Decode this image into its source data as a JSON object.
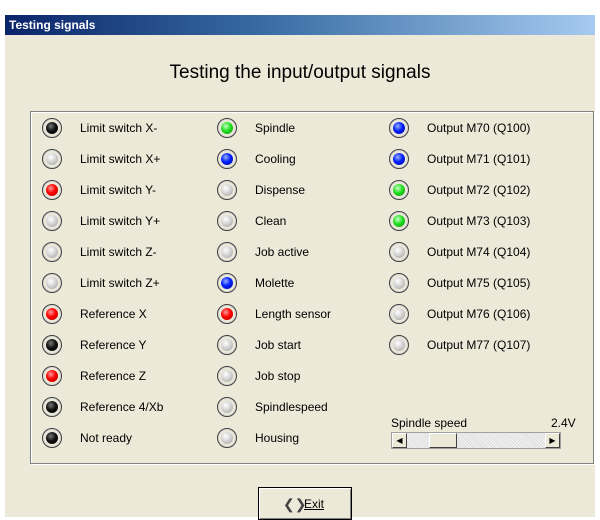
{
  "window": {
    "title": "Testing signals"
  },
  "heading": "Testing the input/output signals",
  "columns": [
    [
      {
        "label": "Limit switch X-",
        "state": "black"
      },
      {
        "label": "Limit switch X+",
        "state": "off"
      },
      {
        "label": "Limit switch Y-",
        "state": "red"
      },
      {
        "label": "Limit switch Y+",
        "state": "off"
      },
      {
        "label": "Limit switch Z-",
        "state": "off"
      },
      {
        "label": "Limit switch Z+",
        "state": "off"
      },
      {
        "label": "Reference X",
        "state": "red"
      },
      {
        "label": "Reference Y",
        "state": "black"
      },
      {
        "label": "Reference Z",
        "state": "red"
      },
      {
        "label": "Reference 4/Xb",
        "state": "black"
      },
      {
        "label": "Not ready",
        "state": "black"
      }
    ],
    [
      {
        "label": "Spindle",
        "state": "green"
      },
      {
        "label": "Cooling",
        "state": "blue"
      },
      {
        "label": "Dispense",
        "state": "off"
      },
      {
        "label": "Clean",
        "state": "off"
      },
      {
        "label": "Job active",
        "state": "off"
      },
      {
        "label": "Molette",
        "state": "blue"
      },
      {
        "label": "Length sensor",
        "state": "red"
      },
      {
        "label": "Job start",
        "state": "off"
      },
      {
        "label": "Job stop",
        "state": "off"
      },
      {
        "label": "Spindlespeed",
        "state": "off"
      },
      {
        "label": "Housing",
        "state": "off"
      }
    ],
    [
      {
        "label": "Output M70 (Q100)",
        "state": "blue"
      },
      {
        "label": "Output M71 (Q101)",
        "state": "blue"
      },
      {
        "label": "Output M72 (Q102)",
        "state": "green"
      },
      {
        "label": "Output M73 (Q103)",
        "state": "green"
      },
      {
        "label": "Output M74 (Q104)",
        "state": "off"
      },
      {
        "label": "Output M75 (Q105)",
        "state": "off"
      },
      {
        "label": "Output M76 (Q106)",
        "state": "off"
      },
      {
        "label": "Output M77 (Q107)",
        "state": "off"
      }
    ]
  ],
  "spindle": {
    "label": "Spindle speed",
    "value": "2.4V",
    "slider_position": 0.2
  },
  "exit_button": {
    "label": "Exit"
  },
  "colors": {
    "titlebar_start": "#0a246a",
    "titlebar_end": "#a6caf0",
    "window_bg": "#ece9d8"
  }
}
